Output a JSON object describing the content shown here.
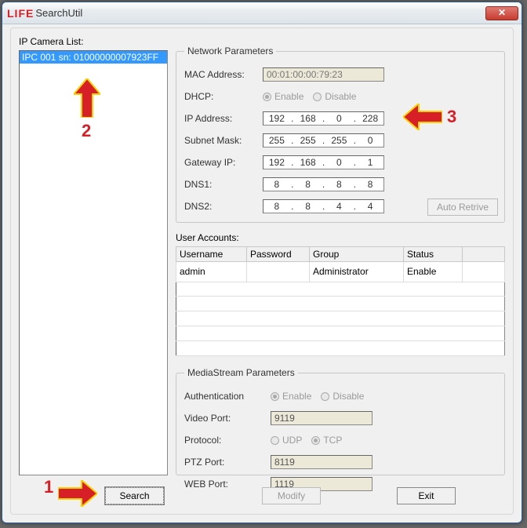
{
  "window": {
    "brand": "LIFE",
    "title": "SearchUtil"
  },
  "listlabel": "IP Camera List:",
  "camlist": {
    "items": [
      "IPC 001 sn: 01000000007923FF"
    ]
  },
  "network": {
    "legend": "Network Parameters",
    "mac_label": "MAC Address:",
    "mac_value": "00:01:00:00:79:23",
    "dhcp_label": "DHCP:",
    "enable_label": "Enable",
    "disable_label": "Disable",
    "ip_label": "IP Address:",
    "ip": [
      "192",
      "168",
      "0",
      "228"
    ],
    "subnet_label": "Subnet Mask:",
    "subnet": [
      "255",
      "255",
      "255",
      "0"
    ],
    "gw_label": "Gateway IP:",
    "gw": [
      "192",
      "168",
      "0",
      "1"
    ],
    "dns1_label": "DNS1:",
    "dns1": [
      "8",
      "8",
      "8",
      "8"
    ],
    "dns2_label": "DNS2:",
    "dns2": [
      "8",
      "8",
      "4",
      "4"
    ],
    "autoretrive": "Auto Retrive"
  },
  "accounts": {
    "label": "User Accounts:",
    "headers": [
      "Username",
      "Password",
      "Group",
      "Status"
    ],
    "row0": {
      "user": "admin",
      "pass": "",
      "group": "Administrator",
      "status": "Enable"
    }
  },
  "media": {
    "legend": "MediaStream Parameters",
    "auth_label": "Authentication",
    "enable_label": "Enable",
    "disable_label": "Disable",
    "vport_label": "Video Port:",
    "vport": "9119",
    "proto_label": "Protocol:",
    "udp_label": "UDP",
    "tcp_label": "TCP",
    "ptz_label": "PTZ Port:",
    "ptz": "8119",
    "web_label": "WEB Port:",
    "web": "1119"
  },
  "buttons": {
    "search": "Search",
    "modify": "Modify",
    "exit": "Exit"
  },
  "annotations": {
    "n1": "1",
    "n2": "2",
    "n3": "3"
  }
}
